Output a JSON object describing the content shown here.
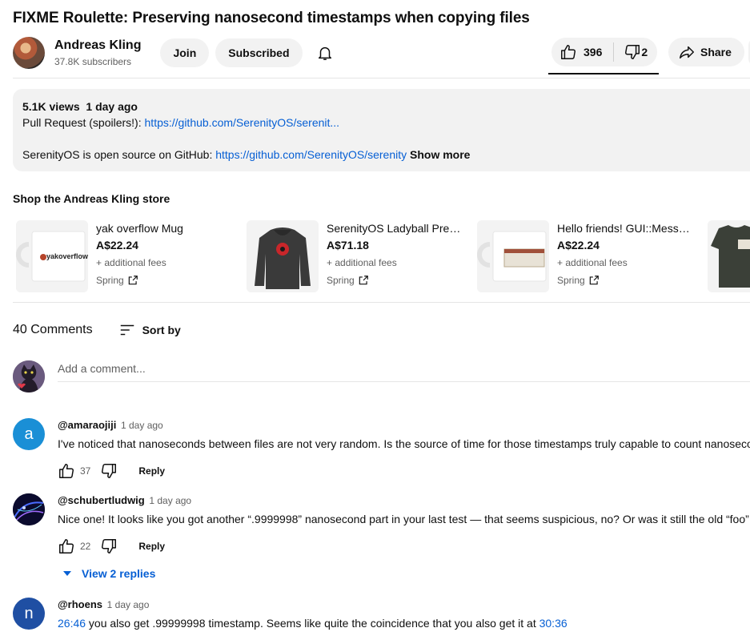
{
  "video": {
    "title": "FIXME Roulette: Preserving nanosecond timestamps when copying files"
  },
  "channel": {
    "name": "Andreas Kling",
    "subscribers": "37.8K subscribers",
    "join_label": "Join",
    "subscribed_label": "Subscribed"
  },
  "actions": {
    "like_count": "396",
    "dislike_count": "2",
    "share_label": "Share"
  },
  "description": {
    "views": "5.1K views",
    "age": "1 day ago",
    "line1_prefix": "Pull Request (spoilers!): ",
    "line1_link": "https://github.com/SerenityOS/serenit...",
    "line2_prefix": "SerenityOS is open source on GitHub: ",
    "line2_link": "https://github.com/SerenityOS/serenity",
    "show_more": "Show more"
  },
  "shop": {
    "title": "Shop the Andreas Kling store",
    "items": [
      {
        "name": "yak overflow Mug",
        "price": "A$22.24",
        "fees": "+ additional fees",
        "vendor": "Spring",
        "thumb_text": "yakoverflow"
      },
      {
        "name": "SerenityOS Ladyball Premi...",
        "price": "A$71.18",
        "fees": "+ additional fees",
        "vendor": "Spring"
      },
      {
        "name": "Hello friends! GUI::Messa...",
        "price": "A$22.24",
        "fees": "+ additional fees",
        "vendor": "Spring"
      }
    ]
  },
  "comments": {
    "count_label": "40 Comments",
    "sort_label": "Sort by",
    "add_placeholder": "Add a comment...",
    "items": [
      {
        "avatar_letter": "a",
        "avatar_color": "#1a8fd6",
        "author": "@amaraojiji",
        "time": "1 day ago",
        "text": "I've noticed that nanoseconds between files are not very random. Is the source of time for those timestamps truly capable to count nanoseconds?",
        "likes": "37",
        "reply_label": "Reply"
      },
      {
        "author": "@schubertludwig",
        "time": "1 day ago",
        "text": "Nice one! It looks like you got another “.9999998” nanosecond part in your last test — that seems suspicious, no? Or was it still the old “foo” file?",
        "likes": "22",
        "reply_label": "Reply",
        "view_replies": "View 2 replies"
      },
      {
        "avatar_letter": "n",
        "avatar_color": "#1f4fa3",
        "author": "@rhoens",
        "time": "1 day ago",
        "ts1": "26:46",
        "text_mid": " you also get .99999998 timestamp. Seems like quite the coincidence that you also get it at ",
        "ts2": "30:36"
      }
    ]
  }
}
